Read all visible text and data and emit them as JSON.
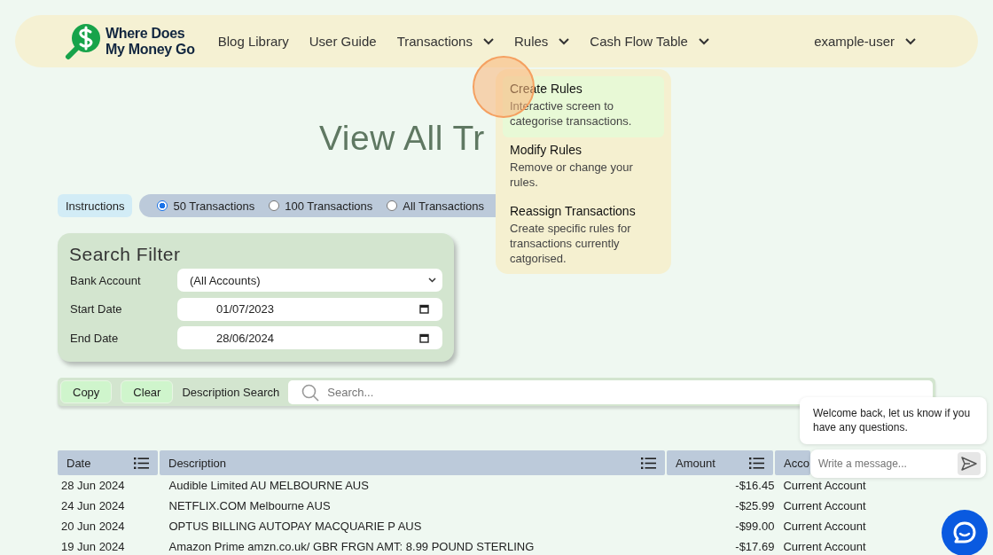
{
  "nav": {
    "logo": [
      "Where Does",
      "My Money Go"
    ],
    "items": [
      {
        "label": "Blog Library",
        "dropdown": false
      },
      {
        "label": "User Guide",
        "dropdown": false
      },
      {
        "label": "Transactions",
        "dropdown": true
      },
      {
        "label": "Rules",
        "dropdown": true
      },
      {
        "label": "Cash Flow Table",
        "dropdown": true
      }
    ],
    "user": "example-user"
  },
  "rules_menu": [
    {
      "title": "Create Rules",
      "description": "Interactive screen to categorise transactions.",
      "selected": true
    },
    {
      "title": "Modify Rules",
      "description": "Remove or change your rules.",
      "selected": false
    },
    {
      "title": "Reassign Transactions",
      "description": "Create specific rules for transactions currently catgorised.",
      "selected": false
    }
  ],
  "title": "View All Tr",
  "instructions": "Instructions",
  "limits": [
    {
      "label": "50 Transactions",
      "selected": true
    },
    {
      "label": "100 Transactions",
      "selected": false
    },
    {
      "label": "All Transactions",
      "selected": false
    }
  ],
  "filter": {
    "title": "Search Filter",
    "fields": [
      {
        "label": "Bank Account",
        "value": "(All Accounts)",
        "kind": "select"
      },
      {
        "label": "Start Date",
        "value": "01/07/2023",
        "kind": "date"
      },
      {
        "label": "End Date",
        "value": "28/06/2024",
        "kind": "date"
      }
    ]
  },
  "toolbar": {
    "buttons": [
      "Copy",
      "Clear"
    ],
    "search_label": "Description Search",
    "placeholder": "Search..."
  },
  "table": {
    "columns": [
      {
        "label": "Date",
        "menu": true
      },
      {
        "label": "Description",
        "menu": true
      },
      {
        "label": "Amount",
        "menu": true
      },
      {
        "label": "Acco",
        "menu": false
      }
    ],
    "rows": [
      [
        "28 Jun 2024",
        "Audible Limited AU MELBOURNE AUS",
        "-$16.45",
        "Current Account"
      ],
      [
        "24 Jun 2024",
        "NETFLIX.COM Melbourne AUS",
        "-$25.99",
        "Current Account"
      ],
      [
        "20 Jun 2024",
        "OPTUS BILLING AUTOPAY MACQUARIE P AUS",
        "-$99.00",
        "Current Account"
      ],
      [
        "19 Jun 2024",
        "Amazon Prime amzn.co.uk/ GBR FRGN AMT: 8.99 POUND STERLING",
        "-$17.69",
        "Current Account"
      ]
    ]
  },
  "chat": {
    "message": "Welcome back, let us know if you have any questions.",
    "placeholder": "Write a message..."
  }
}
